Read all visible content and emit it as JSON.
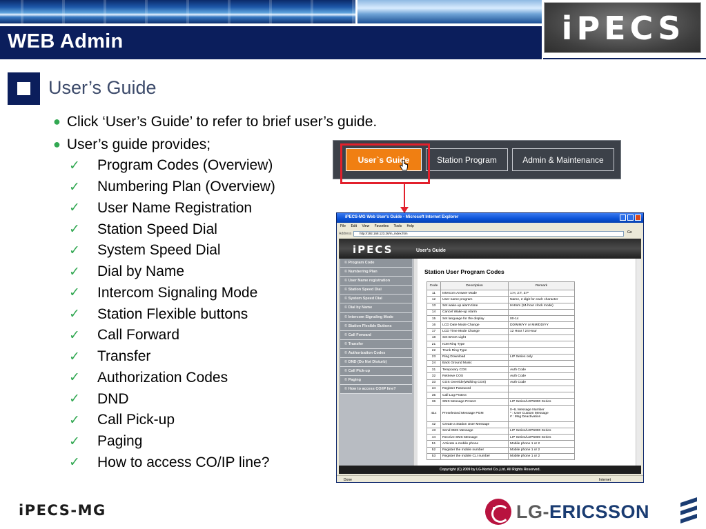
{
  "header": {
    "title": "WEB Admin",
    "brand_logo": "iPECS"
  },
  "section": {
    "title": "User’s Guide"
  },
  "bullets": [
    "Click ‘User’s Guide’ to refer to brief user’s guide.",
    "User’s guide provides;"
  ],
  "checklist": [
    "Program Codes (Overview)",
    "Numbering Plan (Overview)",
    "User Name Registration",
    "Station Speed Dial",
    "System Speed Dial",
    "Dial by Name",
    "Intercom Signaling Mode",
    "Station Flexible buttons",
    "Call Forward",
    "Transfer",
    "Authorization Codes",
    "DND",
    "Call Pick-up",
    "Paging",
    "How to access CO/IP line?"
  ],
  "tabs": [
    "User`s Guide",
    "Station Program",
    "Admin & Maintenance"
  ],
  "browser": {
    "title": "iPECS-MG Web User's Guide - Microsoft Internet Explorer",
    "menu": "File Edit View Favorites Tools Help",
    "address_label": "Address",
    "address": "http://192.168.123.26/m_index.htm",
    "go": "Go",
    "banner_logo": "iPECS",
    "banner_label": "User's Guide",
    "nav": [
      "Program Code",
      "Numbering Plan",
      "User Name registration",
      "Station Speed Dial",
      "System Speed Dial",
      "Dial by Name",
      "Intercom Signaling Mode",
      "Station Flexible Buttons",
      "Call Forward",
      "Transfer",
      "Authorization Codes",
      "DND (Do Not Disturb)",
      "Call Pick-up",
      "Paging",
      "How to access CO/IP line?"
    ],
    "heading": "Station User Program Codes",
    "table_headers": [
      "Code",
      "Description",
      "Remark"
    ],
    "table_rows": [
      [
        "11",
        "Intercom Answer Mode",
        "1:H, 2:T, 3:P"
      ],
      [
        "12",
        "User name program",
        "Name, 2 digit for each character"
      ],
      [
        "13",
        "Set wake-up alarm time",
        "HHmm (24-hour clock mode)"
      ],
      [
        "14",
        "Cancel Wake-up Alarm",
        ""
      ],
      [
        "15",
        "Set language for the display",
        "00-14"
      ],
      [
        "16",
        "LCD Date Mode Change",
        "DD/MM/YY or MM/DD/YY"
      ],
      [
        "17",
        "LCD Time Mode Change",
        "12 Hour / 24 Hour"
      ],
      [
        "18",
        "Set BACK Light",
        ""
      ],
      [
        "21",
        "ICM Ring Type",
        ""
      ],
      [
        "22",
        "Trunk Ring Type",
        ""
      ],
      [
        "23",
        "Ring Download",
        "LIP Series only"
      ],
      [
        "24",
        "Back Ground Music",
        ""
      ],
      [
        "31",
        "Temporary COS",
        "Auth Code"
      ],
      [
        "32",
        "Retrieve COS",
        "Auth Code"
      ],
      [
        "33",
        "COS Override(Walking COS)",
        "Auth Code"
      ],
      [
        "34",
        "Register Password",
        ""
      ],
      [
        "35",
        "Call Log Protect",
        ""
      ],
      [
        "36",
        "SMS Message Protect",
        "LIP Series/LDP6000 Series"
      ],
      [
        "41x",
        "Preselected Message PGM",
        "0~9, Message Number\n* : User Custom Message\n# : Msg Deactivation"
      ],
      [
        "42",
        "Create a Station User Message",
        ""
      ],
      [
        "43",
        "Send SMS Message",
        "LIP Series/LDP6000 Series"
      ],
      [
        "44",
        "Receive SMS Message",
        "LIP Series/LDP6000 Series"
      ],
      [
        "51",
        "Activate a mobile phone",
        "Mobile phone 1 or 2"
      ],
      [
        "52",
        "Register the mobile number",
        "Mobile phone 1 or 2"
      ],
      [
        "53",
        "Register the mobile CLI number",
        "Mobile phone 1 or 2"
      ]
    ],
    "footer": "Copyright (C) 2009 by LG-Nortel Co.,Ltd. All Rights Reserved.",
    "status_left": "Done",
    "status_right": "Internet"
  },
  "footer": {
    "left_logo": "iPECS-MG",
    "right_logo_lg": "LG",
    "right_logo_dash": "-",
    "right_logo_ericsson": "ERICSSON"
  },
  "colors": {
    "navy": "#0b1e5c",
    "check_green": "#32a852",
    "tab_orange": "#f07f12",
    "highlight_red": "#e2202c",
    "lg_red": "#b8133f"
  }
}
